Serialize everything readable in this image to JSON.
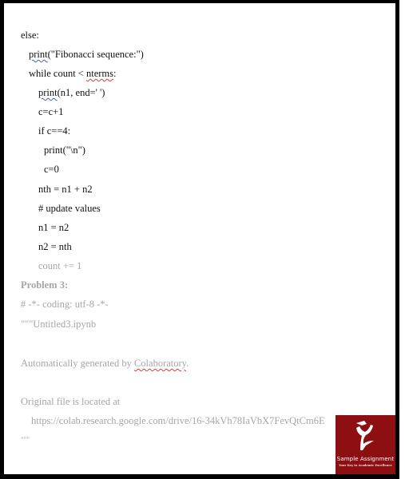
{
  "document": {
    "code_lines": [
      {
        "text_before": "",
        "flag": "",
        "text_after": "else:"
      },
      {
        "flag": "print",
        "text_after": "(\"Fibonacci sequence:\")"
      },
      {
        "text_before": "while count < ",
        "flag": "nterms",
        "text_after": ":"
      },
      {
        "flag": "print",
        "text_after": "(n1, end=' ')"
      },
      {
        "text": "c=c+1"
      },
      {
        "text": "if c==4:"
      },
      {
        "text": "print(\"\\n\")"
      },
      {
        "text": "c=0"
      },
      {
        "text": "nth = n1 + n2"
      },
      {
        "text": "# update values"
      },
      {
        "text": "n1 = n2"
      },
      {
        "text": "n2 = nth"
      },
      {
        "text": "count += 1"
      }
    ],
    "problem_heading": "Problem 3:",
    "coding_line": "# -*- coding: utf-8 -*-",
    "docstring_open": "\"\"\"Untitled3.ipynb",
    "generated_by_prefix": "Automatically generated by ",
    "generated_by_link": "Colaboratory",
    "generated_by_suffix": ".",
    "original_file_label": "Original file is located at",
    "original_file_url": "https://colab.research.google.com/drive/16-34kVh78IaVbX7FevQtCm6E",
    "docstring_close": "\"\"\""
  },
  "watermark": {
    "brand": "Sample Assignment",
    "tagline": "Your Key to Academic Excellence",
    "color": "#8e0f12"
  }
}
